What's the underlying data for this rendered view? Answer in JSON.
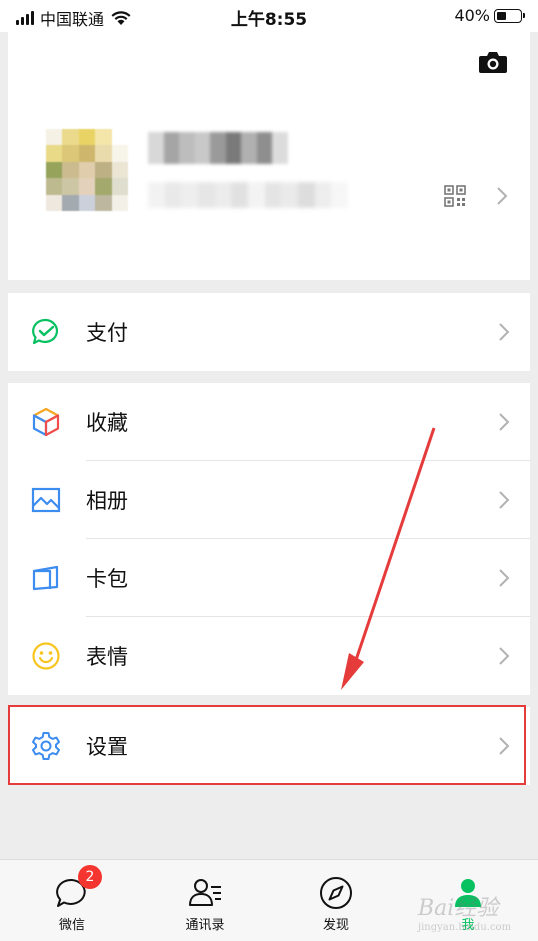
{
  "status_bar": {
    "carrier": "中国联通",
    "time": "上午8:55",
    "battery": "40%",
    "battery_level": 0.4
  },
  "menu": {
    "pay": "支付",
    "favorites": "收藏",
    "album": "相册",
    "cards": "卡包",
    "stickers": "表情",
    "settings": "设置"
  },
  "tabbar": {
    "chats": "微信",
    "chats_badge": "2",
    "contacts": "通讯录",
    "discover": "发现",
    "me": "我"
  },
  "watermark": {
    "text": "Bai经验",
    "sub": "jingyan.baidu.com"
  },
  "colors": {
    "accent": "#07c160",
    "highlight": "#e53b3b",
    "badge": "#f43530"
  }
}
